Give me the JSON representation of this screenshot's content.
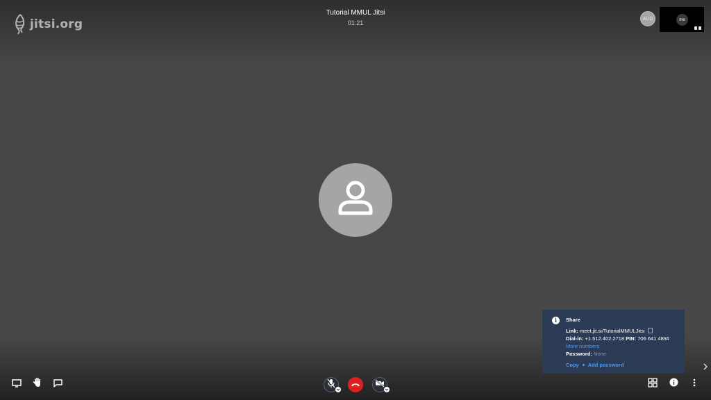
{
  "app": {
    "logo_text": "jitsi.org"
  },
  "header": {
    "title": "Tutorial MMUL Jitsi",
    "timer": "01:21"
  },
  "participants": {
    "remote_initials": "AUD",
    "local_initials": "me"
  },
  "share": {
    "title": "Share",
    "link_label": "Link:",
    "link_value": "meet.jit.si/TutorialMMULJitsi",
    "dialin_label": "Dial-in:",
    "dialin_value": "+1.512.402.2718",
    "pin_label": "PIN:",
    "pin_value": "706 641 489#",
    "more_numbers": "More numbers",
    "password_label": "Password:",
    "password_value": "None",
    "copy_label": "Copy",
    "add_password_label": "Add password"
  },
  "icons": {
    "screenshare": "screen-share-icon",
    "raise_hand": "raise-hand-icon",
    "chat": "chat-icon",
    "microphone": "microphone-muted-icon",
    "hangup": "hangup-icon",
    "camera": "camera-muted-icon",
    "tile_view": "tile-view-icon",
    "info": "info-icon",
    "more": "more-options-icon"
  },
  "colors": {
    "background": "#474747",
    "panel": "#2b3a55",
    "link": "#4a9bf5",
    "hangup": "#dd2121",
    "avatar": "#a5a5a5"
  }
}
